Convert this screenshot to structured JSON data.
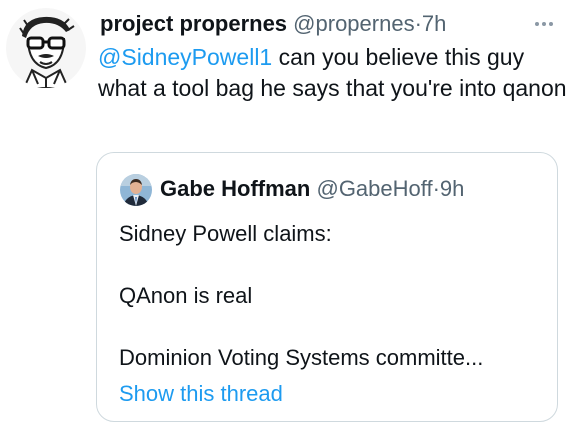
{
  "tweet": {
    "display_name": "project propernes",
    "handle": "@propernes",
    "separator": "·",
    "time": "7h",
    "avatar_icon": "sketched-face-with-glasses-avatar",
    "more_icon": "more-horizontal-icon",
    "mention": "@SidneyPowell1",
    "text": " can you believe this guy what a tool bag he says that you're into qanon"
  },
  "quote": {
    "display_name": "Gabe Hoffman",
    "handle": "@GabeHoff",
    "separator": "·",
    "time": "9h",
    "avatar_icon": "man-in-suit-avatar",
    "lines": [
      "Sidney Powell claims:",
      "QAnon is real",
      "Dominion Voting Systems committe..."
    ],
    "show_thread": "Show this thread"
  },
  "colors": {
    "link": "#1d9bf0",
    "secondary_text": "#536471",
    "border": "#cfd9de"
  }
}
